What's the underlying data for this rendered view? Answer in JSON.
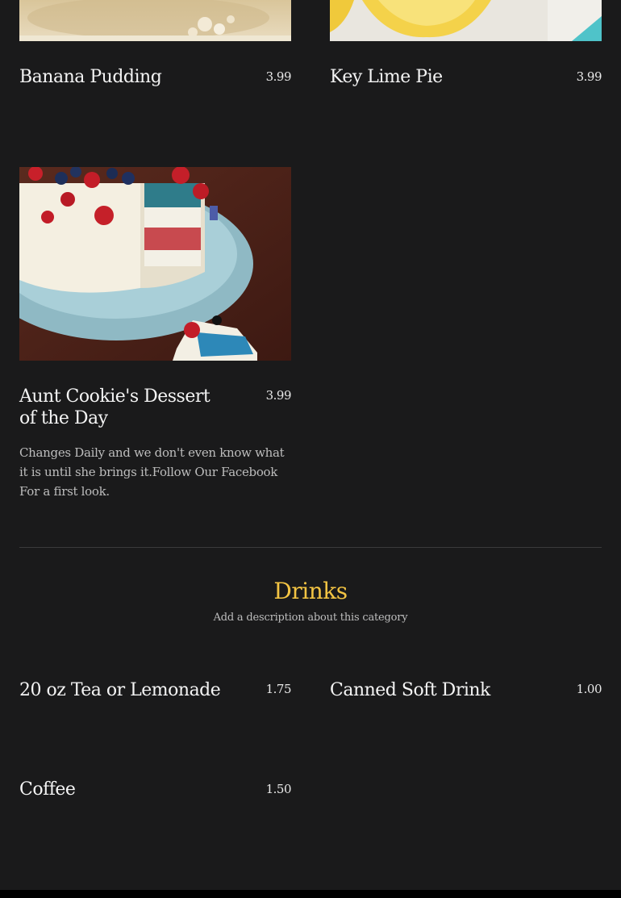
{
  "desserts": {
    "items": [
      {
        "name": "Banana Pudding",
        "price": "3.99"
      },
      {
        "name": "Key Lime Pie",
        "price": "3.99"
      },
      {
        "name": "Aunt Cookie's Dessert of the Day",
        "price": "3.99",
        "description": "Changes Daily and we don't even know what it is until she brings it.Follow Our Facebook For a first look."
      }
    ]
  },
  "drinks": {
    "title": "Drinks",
    "description": "Add a description about this category",
    "items": [
      {
        "name": "20 oz Tea or Lemonade",
        "price": "1.75"
      },
      {
        "name": "Canned Soft Drink",
        "price": "1.00"
      },
      {
        "name": "Coffee",
        "price": "1.50"
      }
    ]
  },
  "colors": {
    "background": "#1a1a1b",
    "category_title": "#f3c443",
    "divider": "#3a3a3b"
  }
}
